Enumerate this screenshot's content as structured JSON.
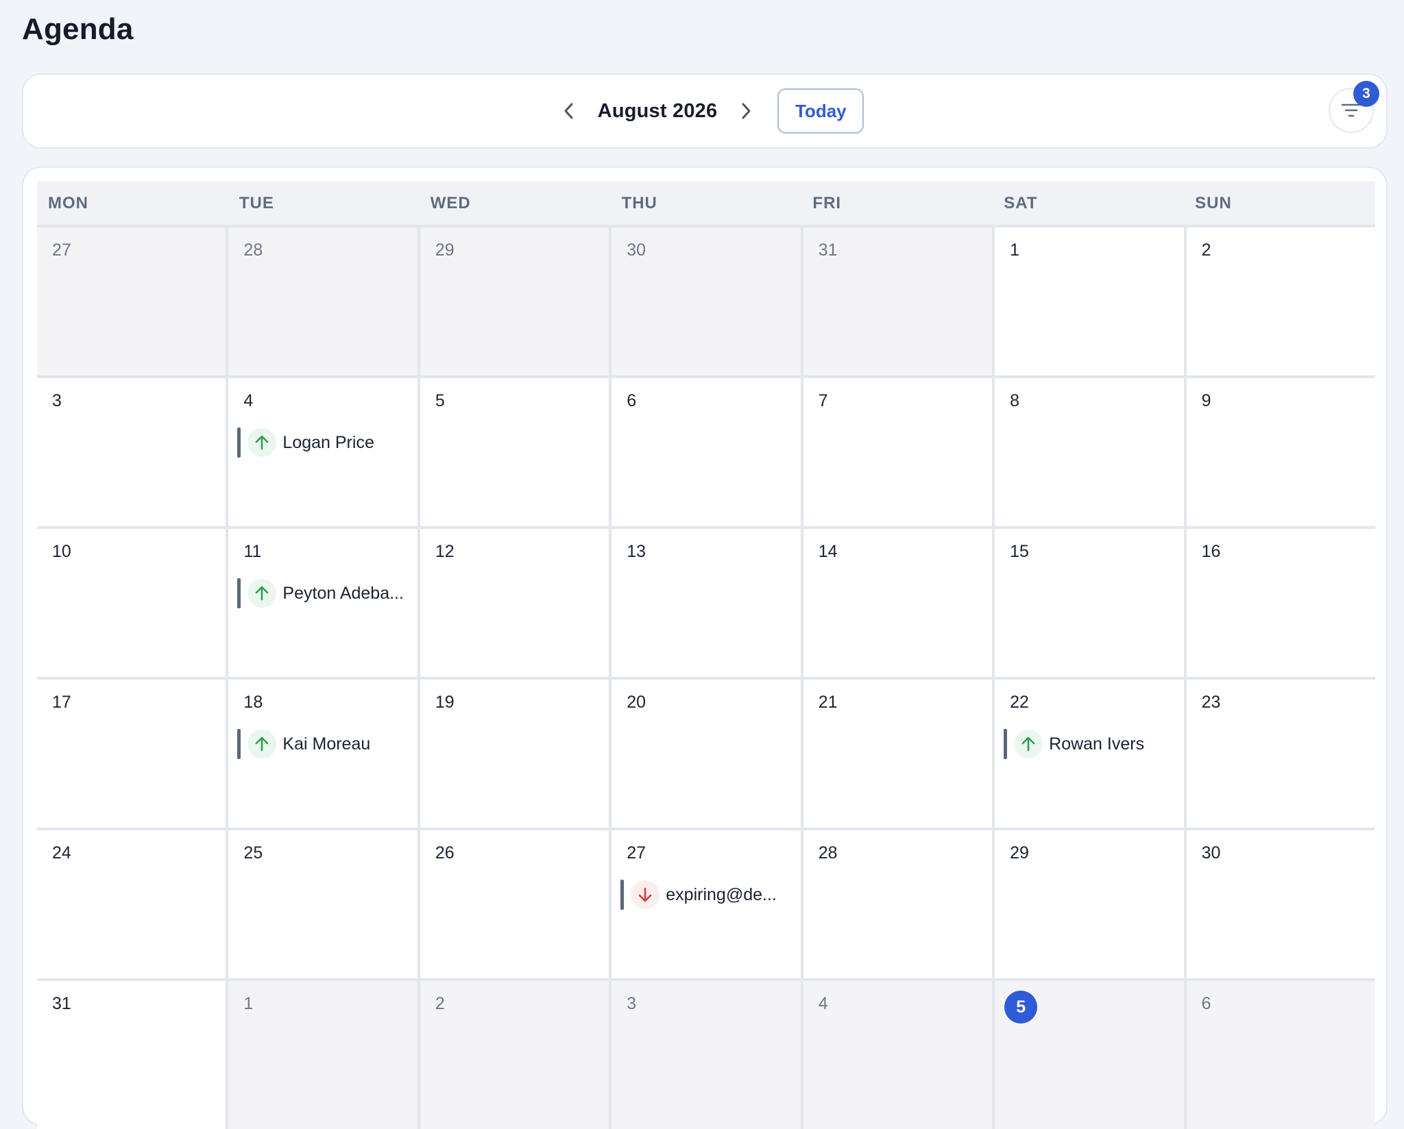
{
  "page": {
    "title": "Agenda"
  },
  "toolbar": {
    "month_label": "August 2026",
    "today_label": "Today",
    "filter_count": "3",
    "prev_icon": "chevron-left-icon",
    "next_icon": "chevron-right-icon",
    "filter_icon": "filter-icon"
  },
  "colors": {
    "accent": "#2f5bd6",
    "up_arrow": "#2e9e4f",
    "down_arrow": "#d63b3b"
  },
  "calendar": {
    "weekdays": [
      "MON",
      "TUE",
      "WED",
      "THU",
      "FRI",
      "SAT",
      "SUN"
    ],
    "weeks": [
      [
        {
          "day": "27",
          "outside": true
        },
        {
          "day": "28",
          "outside": true
        },
        {
          "day": "29",
          "outside": true
        },
        {
          "day": "30",
          "outside": true
        },
        {
          "day": "31",
          "outside": true
        },
        {
          "day": "1"
        },
        {
          "day": "2"
        }
      ],
      [
        {
          "day": "3"
        },
        {
          "day": "4",
          "event": {
            "label": "Logan Price",
            "direction": "up"
          }
        },
        {
          "day": "5"
        },
        {
          "day": "6"
        },
        {
          "day": "7"
        },
        {
          "day": "8"
        },
        {
          "day": "9"
        }
      ],
      [
        {
          "day": "10"
        },
        {
          "day": "11",
          "event": {
            "label": "Peyton Adeba...",
            "direction": "up"
          }
        },
        {
          "day": "12"
        },
        {
          "day": "13"
        },
        {
          "day": "14"
        },
        {
          "day": "15"
        },
        {
          "day": "16"
        }
      ],
      [
        {
          "day": "17"
        },
        {
          "day": "18",
          "event": {
            "label": "Kai Moreau",
            "direction": "up"
          }
        },
        {
          "day": "19"
        },
        {
          "day": "20"
        },
        {
          "day": "21"
        },
        {
          "day": "22",
          "event": {
            "label": "Rowan Ivers",
            "direction": "up"
          }
        },
        {
          "day": "23"
        }
      ],
      [
        {
          "day": "24"
        },
        {
          "day": "25"
        },
        {
          "day": "26"
        },
        {
          "day": "27",
          "event": {
            "label": "expiring@de...",
            "direction": "down"
          }
        },
        {
          "day": "28"
        },
        {
          "day": "29"
        },
        {
          "day": "30"
        }
      ],
      [
        {
          "day": "31"
        },
        {
          "day": "1",
          "outside": true
        },
        {
          "day": "2",
          "outside": true
        },
        {
          "day": "3",
          "outside": true
        },
        {
          "day": "4",
          "outside": true
        },
        {
          "day": "5",
          "outside": true,
          "today": true
        },
        {
          "day": "6",
          "outside": true
        }
      ]
    ]
  }
}
